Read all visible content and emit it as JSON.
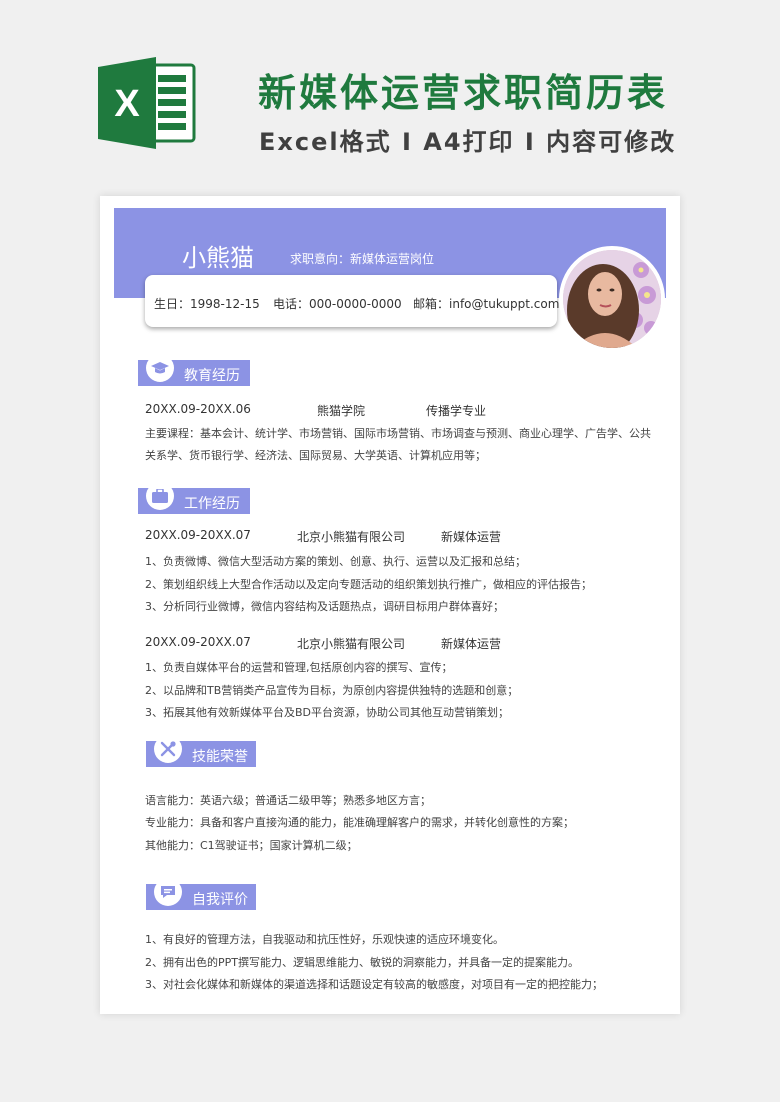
{
  "header": {
    "title": "新媒体运营求职简历表",
    "subtitle": "Excel格式 I A4打印 I 内容可修改",
    "logo_letter": "X"
  },
  "profile": {
    "name": "小熊猫",
    "intent": "求职意向：新媒体运营岗位",
    "birth": "生日：1998-12-15",
    "phone": "电话：000-0000-0000",
    "email": "邮箱：info@tukuppt.com"
  },
  "education": {
    "title": "教育经历",
    "period": "20XX.09-20XX.06",
    "school": "熊猫学院",
    "major": "传播学专业",
    "courses_1": "主要课程：基本会计、统计学、市场营销、国际市场营销、市场调查与预测、商业心理学、广告学、公共",
    "courses_2": "关系学、货币银行学、经济法、国际贸易、大学英语、计算机应用等；"
  },
  "work": {
    "title": "工作经历",
    "jobs": [
      {
        "period": "20XX.09-20XX.07",
        "company": "北京小熊猫有限公司",
        "position": "新媒体运营",
        "duties": [
          "1、负责微博、微信大型活动方案的策划、创意、执行、运营以及汇报和总结；",
          "2、策划组织线上大型合作活动以及定向专题活动的组织策划执行推广，做相应的评估报告；",
          "3、分析同行业微博，微信内容结构及话题热点，调研目标用户群体喜好；"
        ]
      },
      {
        "period": "20XX.09-20XX.07",
        "company": "北京小熊猫有限公司",
        "position": "新媒体运营",
        "duties": [
          "1、负责自媒体平台的运营和管理,包括原创内容的撰写、宣传；",
          "2、以品牌和TB营销类产品宣传为目标，为原创内容提供独特的选题和创意；",
          "3、拓展其他有效新媒体平台及BD平台资源，协助公司其他互动营销策划；"
        ]
      }
    ]
  },
  "skills": {
    "title": "技能荣誉",
    "items": [
      "语言能力：英语六级；普通话二级甲等；熟悉多地区方言；",
      "专业能力：具备和客户直接沟通的能力，能准确理解客户的需求，并转化创意性的方案；",
      "其他能力：C1驾驶证书；国家计算机二级；"
    ]
  },
  "evaluation": {
    "title": "自我评价",
    "items": [
      "1、有良好的管理方法，自我驱动和抗压性好，乐观快速的适应环境变化。",
      "2、拥有出色的PPT撰写能力、逻辑思维能力、敏锐的洞察能力，并具备一定的提案能力。",
      "3、对社会化媒体和新媒体的渠道选择和话题设定有较高的敏感度，对项目有一定的把控能力；"
    ]
  },
  "colors": {
    "accent": "#8c93e4",
    "excel_green": "#1f7a3e"
  },
  "icons": [
    "excel-logo-icon",
    "graduation-cap-icon",
    "briefcase-icon",
    "tools-icon",
    "chat-bubble-icon"
  ]
}
